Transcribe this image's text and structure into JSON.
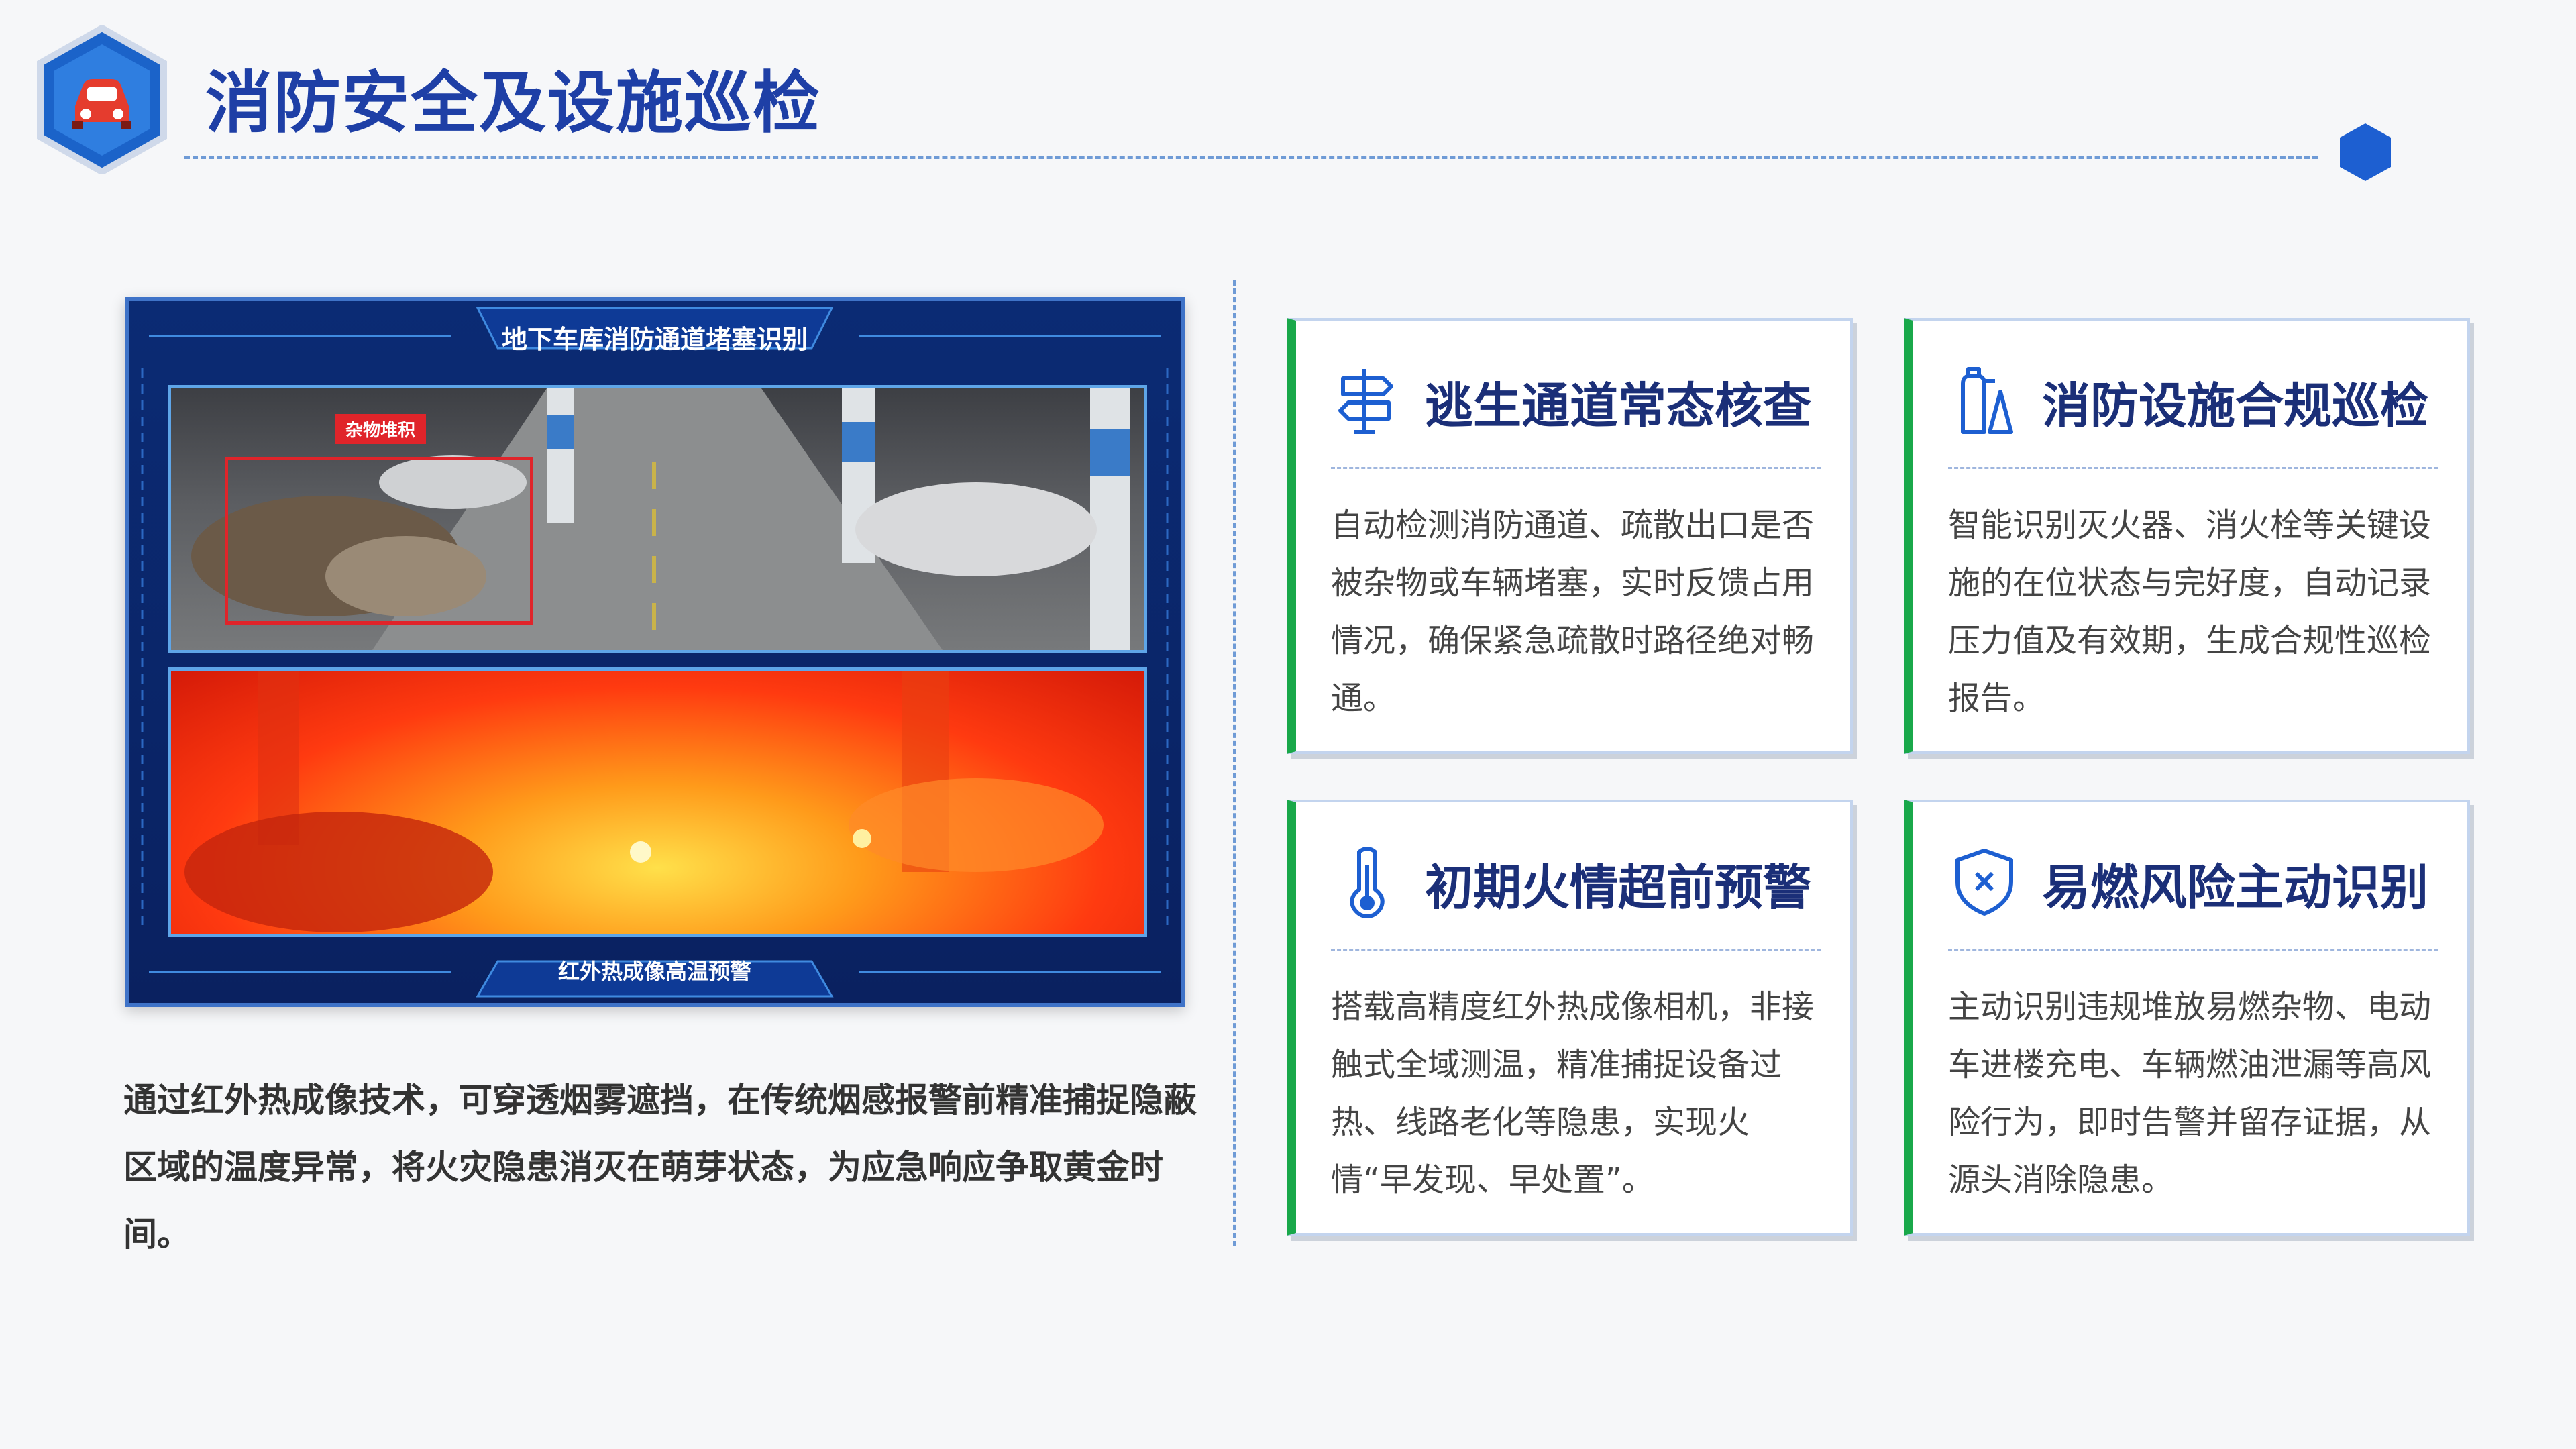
{
  "header": {
    "title": "消防安全及设施巡检",
    "logo_icon": "car-icon"
  },
  "panel": {
    "title": "地下车库消防通道堵塞识别",
    "detection_label": "杂物堆积",
    "bottom_caption": "红外热成像高温预警"
  },
  "description": "通过红外热成像技术，可穿透烟雾遮挡，在传统烟感报警前精准捕捉隐蔽区域的温度异常，将火灾隐患消灭在萌芽状态，为应急响应争取黄金时间。",
  "cards": [
    {
      "icon": "signpost-icon",
      "title": "逃生通道常态核查",
      "body": "自动检测消防通道、疏散出口是否被杂物或车辆堵塞，实时反馈占用情况，确保紧急疏散时路径绝对畅通。"
    },
    {
      "icon": "fire-extinguisher-icon",
      "title": "消防设施合规巡检",
      "body": "智能识别灭火器、消火栓等关键设施的在位状态与完好度，自动记录压力值及有效期，生成合规性巡检报告。"
    },
    {
      "icon": "thermometer-icon",
      "title": "初期火情超前预警",
      "body": "搭载高精度红外热成像相机，非接触式全域测温，精准捕捉设备过热、线路老化等隐患，实现火情“早发现、早处置”。"
    },
    {
      "icon": "shield-x-icon",
      "title": "易燃风险主动识别",
      "body": "主动识别违规堆放易燃杂物、电动车进楼充电、车辆燃油泄漏等高风险行为，即时告警并留存证据，从源头消除隐患。"
    }
  ],
  "colors": {
    "title_blue": "#1e3fa6",
    "accent_green": "#19a84a",
    "panel_navy": "#0b2b74"
  }
}
